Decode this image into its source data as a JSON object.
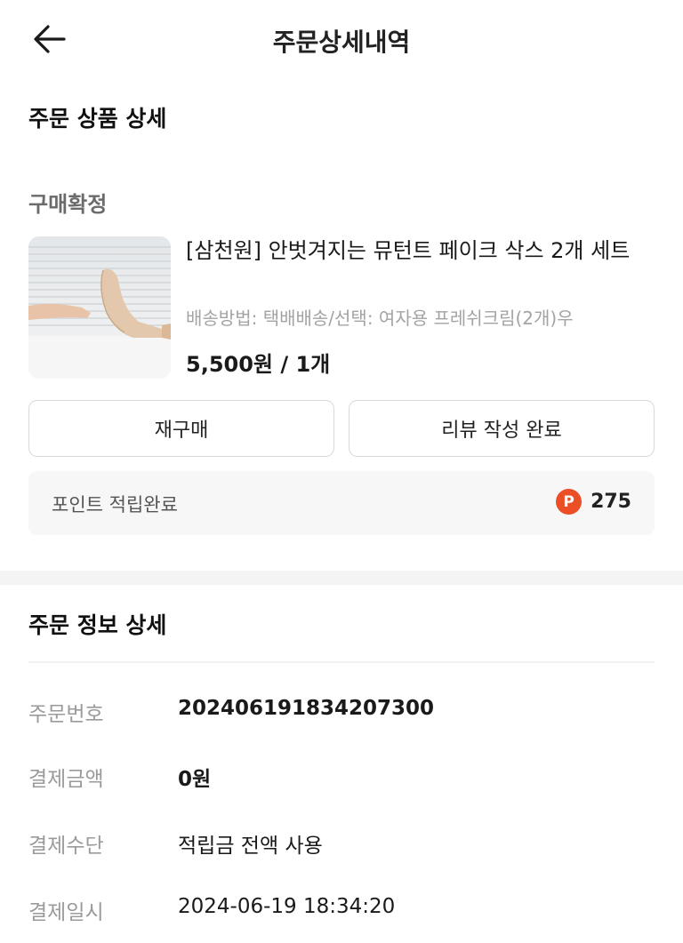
{
  "header": {
    "title": "주문상세내역",
    "back_icon": "arrow-left-icon"
  },
  "order_product": {
    "section_title": "주문 상품 상세",
    "status": "구매확정",
    "product": {
      "name": "[삼천원] 안벗겨지는 뮤턴트 페이크 삭스 2개 세트",
      "option": "배송방법: 택배배송/선택: 여자용 프레쉬크림(2개)우",
      "price": "5,500원 / 1개"
    },
    "buttons": {
      "rebuy": "재구매",
      "review": "리뷰 작성 완료"
    },
    "points": {
      "label": "포인트 적립완료",
      "icon_letter": "P",
      "value": "275",
      "icon_color": "#ec4e26"
    }
  },
  "order_info": {
    "section_title": "주문 정보 상세",
    "rows": [
      {
        "label": "주문번호",
        "value": "20240619183420730​0"
      },
      {
        "label": "결제금액",
        "value": "0원"
      },
      {
        "label": "결제수단",
        "value": "적립금 전액 사용"
      },
      {
        "label": "결제일시",
        "value": "2024-06-19 18:34:20"
      }
    ]
  }
}
